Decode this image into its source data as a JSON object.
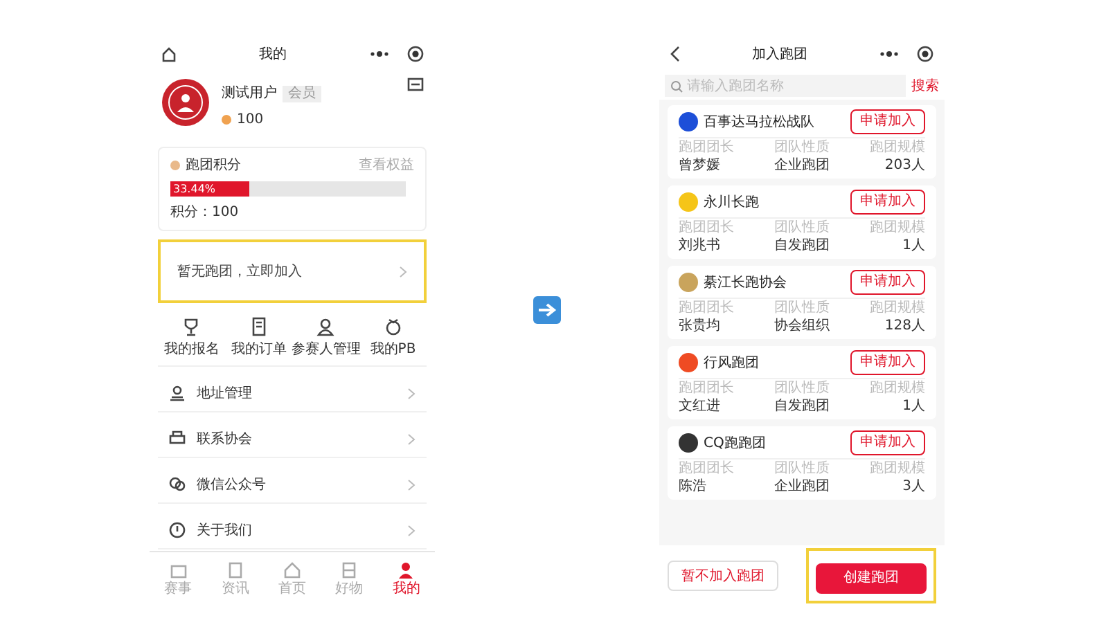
{
  "profile_screen": {
    "title": "我的",
    "user": {
      "name": "测试用户",
      "badge": "会员",
      "points": "100"
    },
    "team_card": {
      "title": "跑团积分",
      "link": "查看权益",
      "progress": {
        "level": 0.3344,
        "label": "33.44%"
      },
      "score": "积分：100"
    },
    "join_card": {
      "text": "暂无跑团，立即加入",
      "highlighted": true
    },
    "shortcuts": [
      {
        "label": "我的报名"
      },
      {
        "label": "我的订单"
      },
      {
        "label": "参赛人管理"
      },
      {
        "label": "我的PB"
      }
    ],
    "menu": [
      {
        "label": "地址管理"
      },
      {
        "label": "联系协会"
      },
      {
        "label": "微信公众号"
      },
      {
        "label": "关于我们"
      }
    ],
    "tabs": [
      {
        "label": "赛事",
        "selected": false
      },
      {
        "label": "资讯",
        "selected": false
      },
      {
        "label": "首页",
        "selected": false
      },
      {
        "label": "好物",
        "selected": false
      },
      {
        "label": "我的",
        "selected": true
      }
    ]
  },
  "join_screen": {
    "title": "加入跑团",
    "search": {
      "placeholder": "请输入跑团名称",
      "button": "搜索"
    },
    "teams": [
      {
        "name": "百事达马拉松战队",
        "color": "#1d4fd8",
        "button": "申请加入",
        "fields": [
          {
            "label": "跑团团长",
            "value": "曾梦媛"
          },
          {
            "label": "团队性质",
            "value": "企业跑团"
          },
          {
            "label": "跑团规模",
            "value": "203人"
          }
        ]
      },
      {
        "name": "永川长跑",
        "color": "#f5c518",
        "button": "申请加入",
        "fields": [
          {
            "label": "跑团团长",
            "value": "刘兆书"
          },
          {
            "label": "团队性质",
            "value": "自发跑团"
          },
          {
            "label": "跑团规模",
            "value": "1人"
          }
        ]
      },
      {
        "name": "綦江长跑协会",
        "color": "#c9a45c",
        "button": "申请加入",
        "fields": [
          {
            "label": "跑团团长",
            "value": "张贵均"
          },
          {
            "label": "团队性质",
            "value": "协会组织"
          },
          {
            "label": "跑团规模",
            "value": "128人"
          }
        ]
      },
      {
        "name": "行风跑团",
        "color": "#ef4b23",
        "button": "申请加入",
        "fields": [
          {
            "label": "跑团团长",
            "value": "文红进"
          },
          {
            "label": "团队性质",
            "value": "自发跑团"
          },
          {
            "label": "跑团规模",
            "value": "1人"
          }
        ]
      },
      {
        "name": "CQ跑跑团",
        "color": "#333333",
        "button": "申请加入",
        "fields": [
          {
            "label": "跑团团长",
            "value": "陈浩"
          },
          {
            "label": "团队性质",
            "value": "企业跑团"
          },
          {
            "label": "跑团规模",
            "value": "3人"
          }
        ]
      }
    ],
    "bottom": {
      "secondary": "暂不加入跑团",
      "primary": {
        "label": "创建跑团",
        "highlighted": true
      }
    }
  }
}
